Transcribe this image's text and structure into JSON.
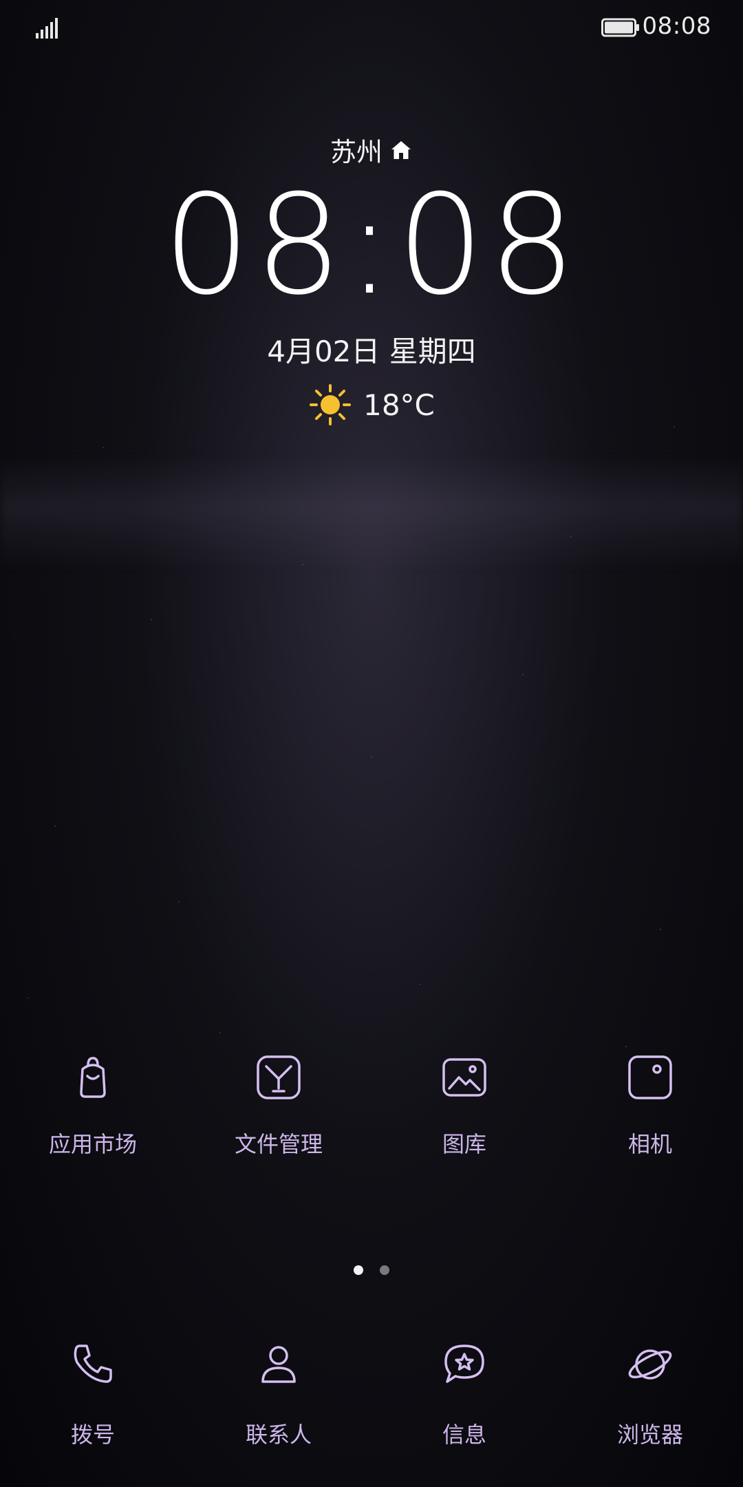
{
  "status_bar": {
    "time": "08:08",
    "signal_icon": "signal-bars-icon",
    "battery_icon": "battery-icon"
  },
  "widget": {
    "city": "苏州",
    "home_icon": "home-icon",
    "time": "08:08",
    "date": "4月02日 星期四",
    "weather_icon": "sun-icon",
    "temperature": "18°C"
  },
  "apps": [
    {
      "label": "应用市场",
      "icon": "app-market-icon"
    },
    {
      "label": "文件管理",
      "icon": "file-manager-icon"
    },
    {
      "label": "图库",
      "icon": "gallery-icon"
    },
    {
      "label": "相机",
      "icon": "camera-icon"
    }
  ],
  "pager": {
    "pages": 2,
    "active_page": 1
  },
  "dock": [
    {
      "label": "拨号",
      "icon": "phone-icon"
    },
    {
      "label": "联系人",
      "icon": "contacts-icon"
    },
    {
      "label": "信息",
      "icon": "messages-icon"
    },
    {
      "label": "浏览器",
      "icon": "browser-icon"
    }
  ],
  "colors": {
    "accent": "#cdb6ea",
    "icon_stroke": "#d5bff0",
    "sun": "#f6c12f",
    "background": "#0a0a0e"
  }
}
